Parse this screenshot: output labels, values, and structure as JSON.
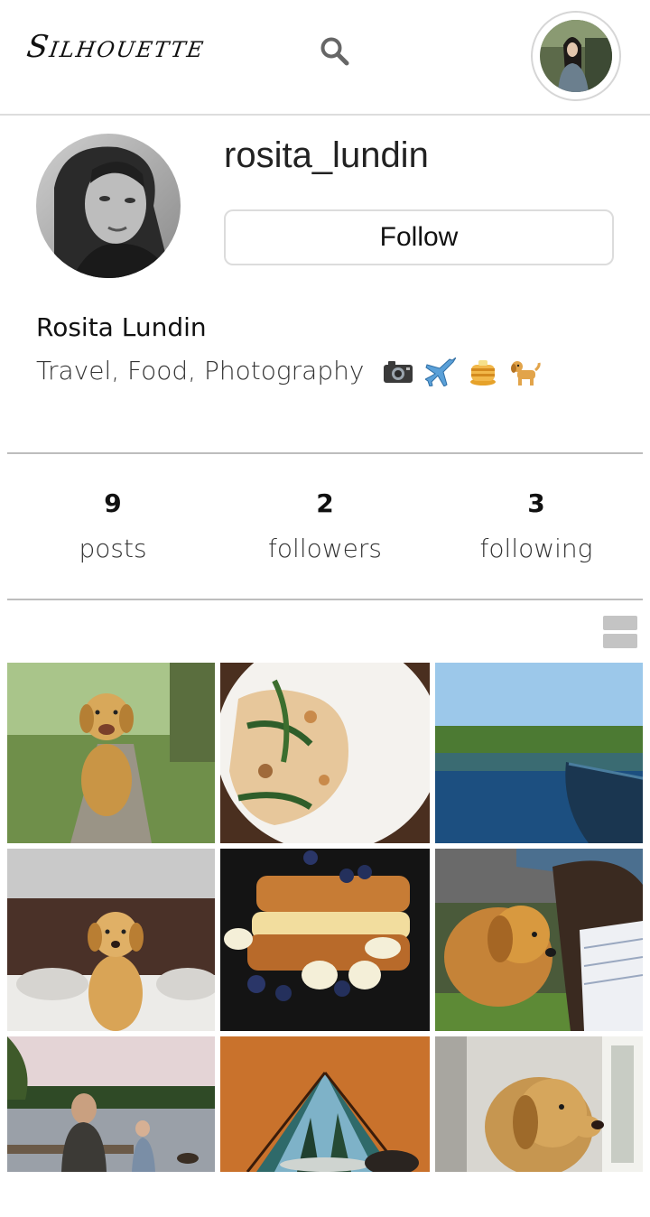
{
  "header": {
    "logo": "Silhouette",
    "search_icon": "search-icon",
    "avatar_icon": "user-avatar"
  },
  "profile": {
    "username": "rosita_lundin",
    "follow_label": "Follow",
    "full_name": "Rosita Lundin",
    "bio": "Travel, Food, Photography",
    "bio_emojis": [
      "camera-icon",
      "airplane-icon",
      "pancakes-icon",
      "dog-icon"
    ]
  },
  "stats": [
    {
      "value": "9",
      "label": "posts"
    },
    {
      "value": "2",
      "label": "followers"
    },
    {
      "value": "3",
      "label": "following"
    }
  ],
  "view_toggle_icon": "list-view-icon",
  "posts": [
    {
      "subject": "golden retriever on garden path"
    },
    {
      "subject": "pasta with greens on white plate"
    },
    {
      "subject": "lake with canoe and forest"
    },
    {
      "subject": "puppy on bed"
    },
    {
      "subject": "french toast with blueberries and banana"
    },
    {
      "subject": "woman with golden retriever"
    },
    {
      "subject": "mother and child by lake with dog"
    },
    {
      "subject": "view from tent to forest"
    },
    {
      "subject": "golden retriever by window"
    }
  ],
  "colors": {
    "border": "#dddddd",
    "divider": "#bdbdbd",
    "toggle": "#c4c4c4"
  }
}
